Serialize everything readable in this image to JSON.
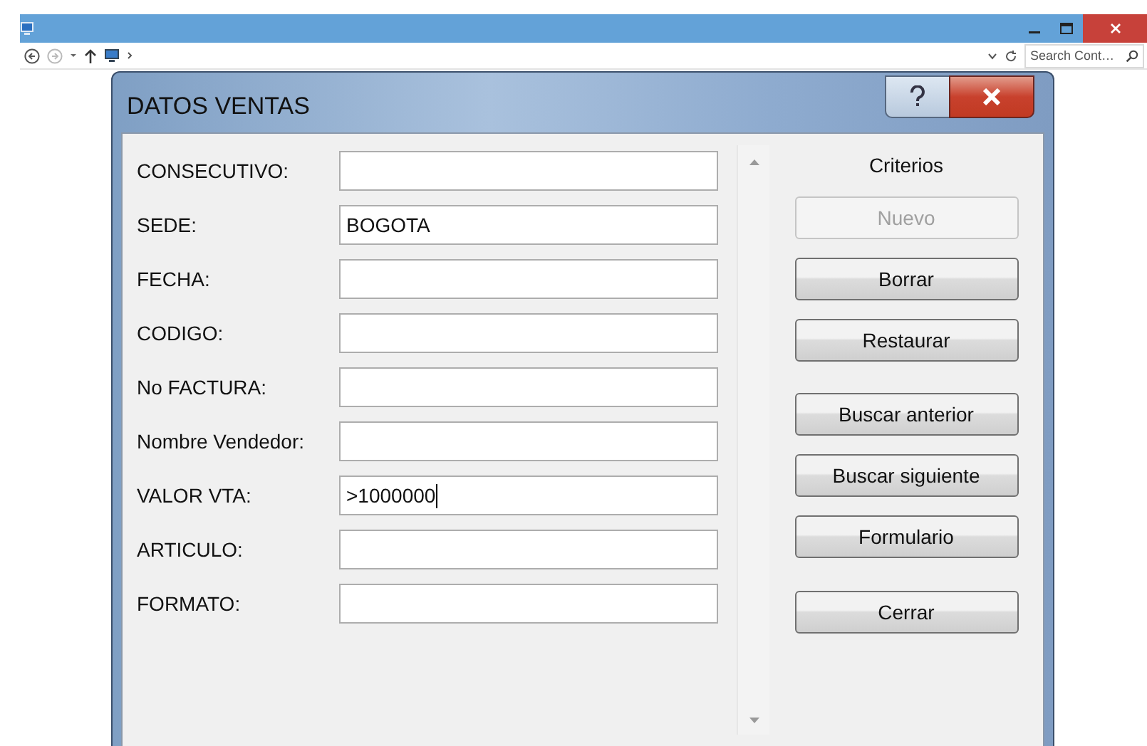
{
  "explorer": {
    "search": {
      "placeholder": "Search Cont…"
    }
  },
  "dialog": {
    "title": "DATOS VENTAS",
    "fields": [
      {
        "label": "CONSECUTIVO:",
        "focused": false
      },
      {
        "label": "SEDE:",
        "value": "BOGOTA",
        "focused": false
      },
      {
        "label": "FECHA:",
        "focused": false
      },
      {
        "label": "CODIGO:",
        "focused": false
      },
      {
        "label": "No FACTURA:",
        "focused": false
      },
      {
        "label": "Nombre Vendedor:",
        "focused": false
      },
      {
        "label": "VALOR VTA:",
        "value": ">1000000",
        "focused": true
      },
      {
        "label": "ARTICULO:",
        "focused": false
      },
      {
        "label": "FORMATO:",
        "focused": false
      }
    ],
    "side_heading": "Criterios",
    "buttons": [
      {
        "label": "Nuevo",
        "disabled": true
      },
      {
        "label": "Borrar",
        "disabled": false
      },
      {
        "label": "Restaurar",
        "disabled": false
      },
      {
        "label": "Buscar anterior",
        "disabled": false
      },
      {
        "label": "Buscar siguiente",
        "disabled": false
      },
      {
        "label": "Formulario",
        "disabled": false
      },
      {
        "label": "Cerrar",
        "disabled": false
      }
    ]
  }
}
